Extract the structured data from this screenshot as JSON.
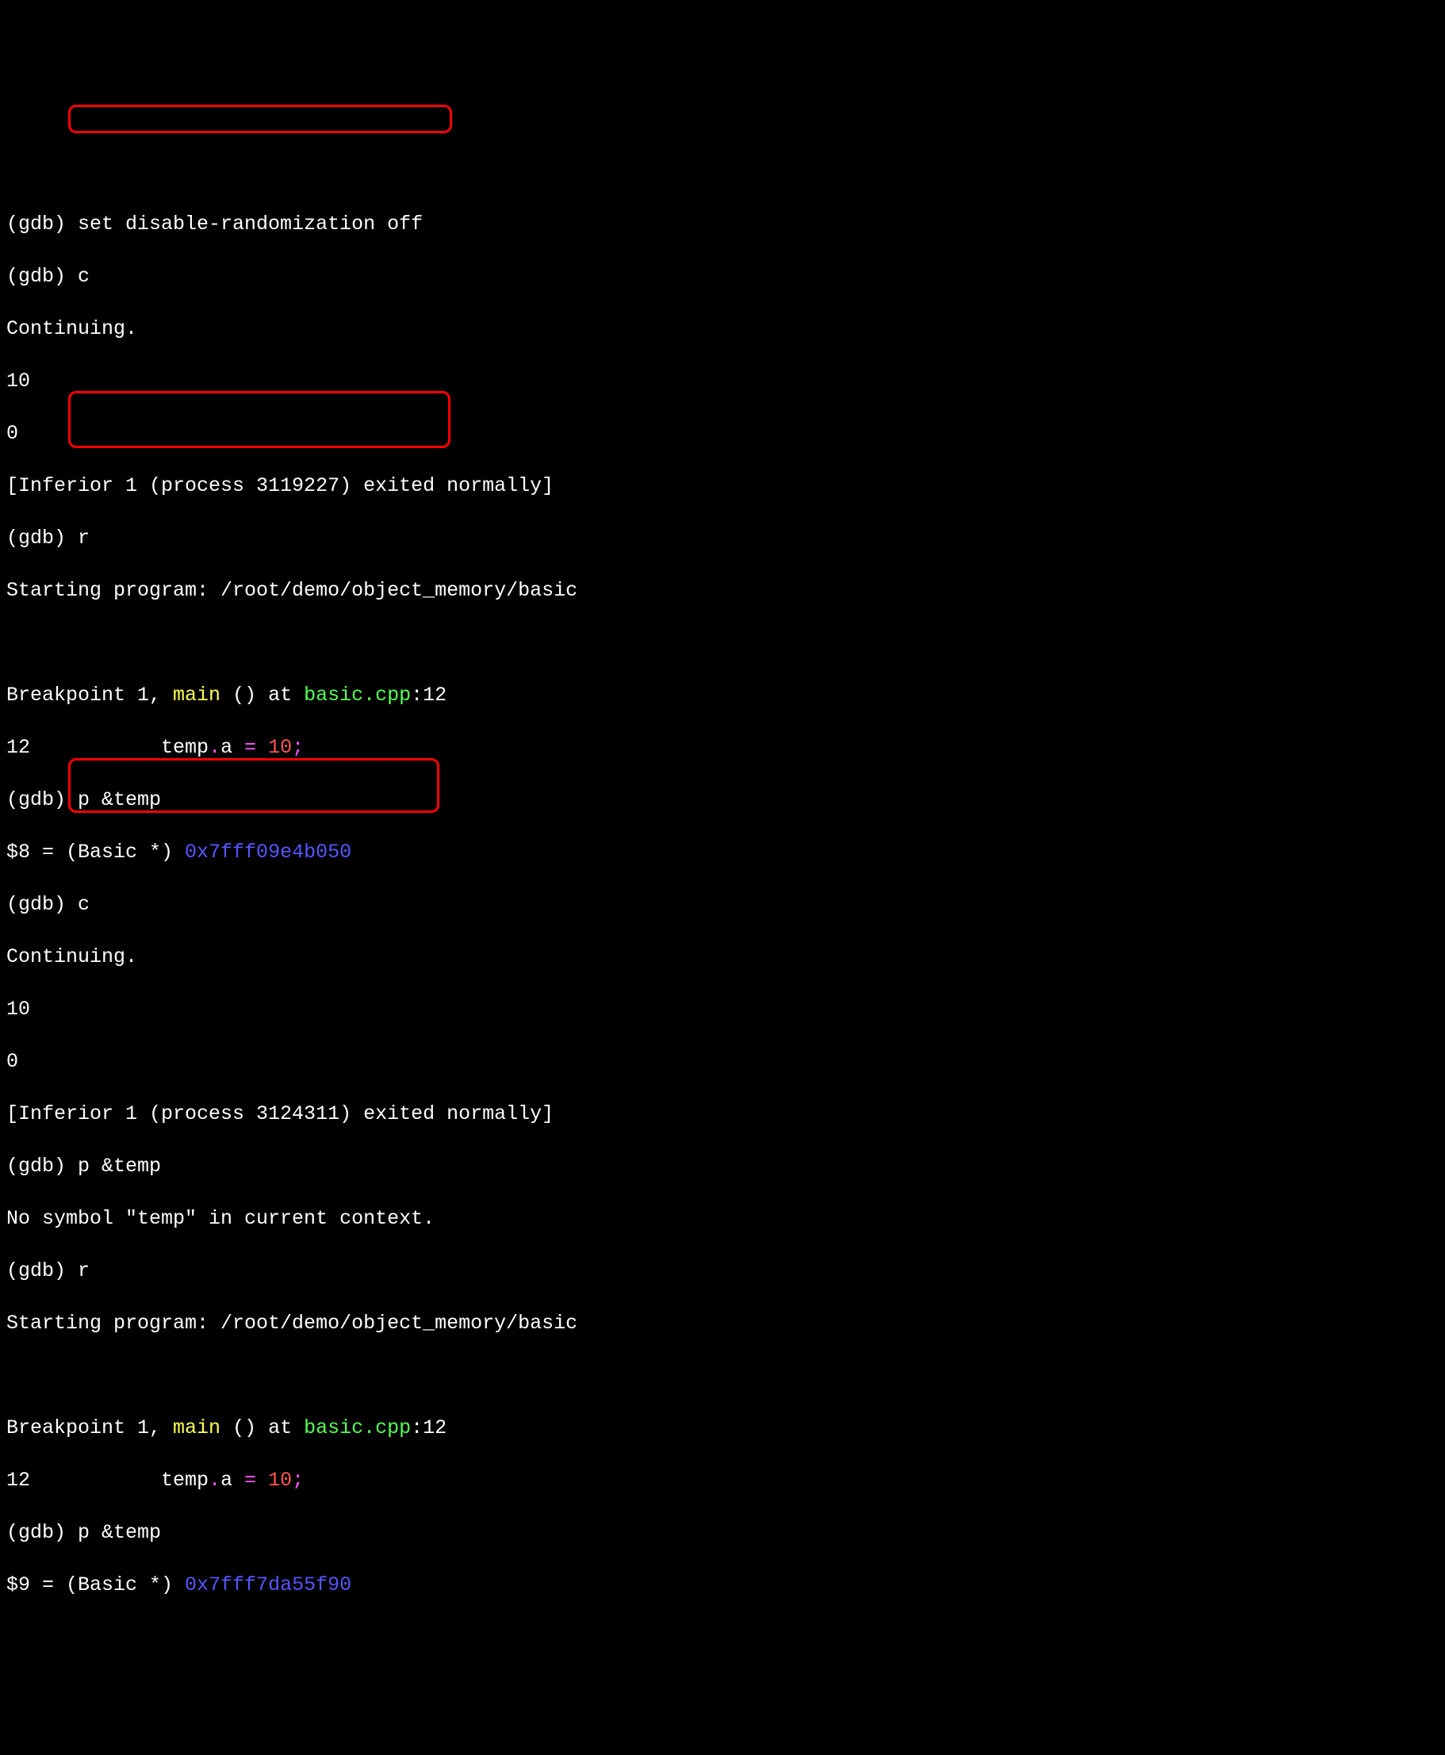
{
  "lines": {
    "l1_prompt": "(gdb) ",
    "l1_cmd": "set disable-randomization off",
    "l2_prompt": "(gdb) ",
    "l2_cmd": "c",
    "l3": "Continuing.",
    "l4": "10",
    "l5": "0",
    "l6": "[Inferior 1 (process 3119227) exited normally]",
    "l7_prompt": "(gdb) ",
    "l7_cmd": "r",
    "l8": "Starting program: /root/demo/object_memory/basic",
    "l9": "",
    "l10_a": "Breakpoint 1, ",
    "l10_b": "main",
    "l10_c": " () at ",
    "l10_d": "basic.cpp",
    "l10_e": ":12",
    "l11_a": "12",
    "l11_b": "           temp",
    "l11_c": ".",
    "l11_d": "a ",
    "l11_e": "= ",
    "l11_f": "10",
    "l11_g": ";",
    "l12_prompt": "(gdb) ",
    "l12_cmd": "p &temp",
    "l13_a": "$8 = (Basic *) ",
    "l13_b": "0x7fff09e4b050",
    "l14_prompt": "(gdb) ",
    "l14_cmd": "c",
    "l15": "Continuing.",
    "l16": "10",
    "l17": "0",
    "l18": "[Inferior 1 (process 3124311) exited normally]",
    "l19_prompt": "(gdb) ",
    "l19_cmd": "p &temp",
    "l20": "No symbol \"temp\" in current context.",
    "l21_prompt": "(gdb) ",
    "l21_cmd": "r",
    "l22": "Starting program: /root/demo/object_memory/basic",
    "l23": "",
    "l24_a": "Breakpoint 1, ",
    "l24_b": "main",
    "l24_c": " () at ",
    "l24_d": "basic.cpp",
    "l24_e": ":12",
    "l25_a": "12",
    "l25_b": "           temp",
    "l25_c": ".",
    "l25_d": "a ",
    "l25_e": "= ",
    "l25_f": "10",
    "l25_g": ";",
    "l26_prompt": "(gdb) ",
    "l26_cmd": "p &temp",
    "l27_a": "$9 = (Basic *) ",
    "l27_b": "0x7fff7da55f90"
  }
}
